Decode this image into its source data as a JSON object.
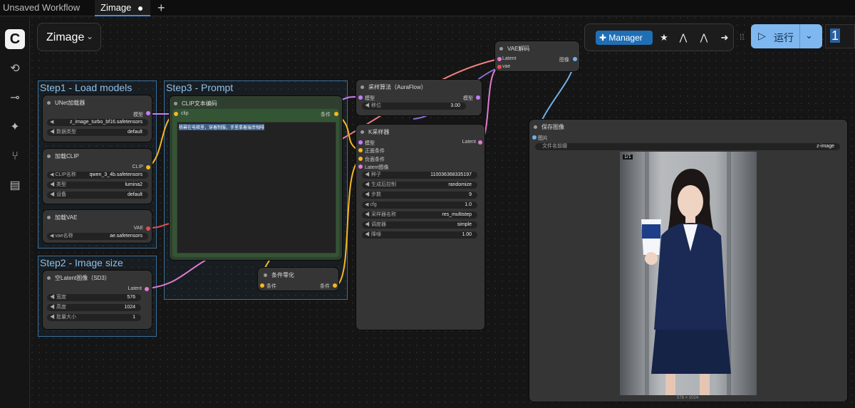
{
  "tabs": [
    {
      "label": "Unsaved Workflow"
    },
    {
      "label": "Zimage"
    }
  ],
  "workflow_select": {
    "label": "Zimage"
  },
  "toolbar": {
    "manager_label": "Manager",
    "run_label": "运行",
    "queue_count": "1"
  },
  "groups": {
    "step1": "Step1 - Load models",
    "step2": "Step2 - Image size",
    "step3": "Step3 - Prompt"
  },
  "nodes": {
    "unet": {
      "title": "UNet加载器",
      "out": "模型",
      "w1_value": "z_image_turbo_bf16.safetensors",
      "w2_label": "数据类型",
      "w2_value": "default"
    },
    "clip_loader": {
      "title": "加载CLIP",
      "out": "CLIP",
      "w1_label": "CLIP名称",
      "w1_value": "qwen_3_4b.safetensors",
      "w2_label": "类型",
      "w2_value": "lumina2",
      "w3_label": "设备",
      "w3_value": "default"
    },
    "vae_loader": {
      "title": "加载VAE",
      "out": "VAE",
      "w1_label": "vae名称",
      "w1_value": "ae.safetensors"
    },
    "latent": {
      "title": "空Latent图像（SD3）",
      "out": "Latent",
      "w1_label": "宽度",
      "w1_value": "576",
      "w2_label": "高度",
      "w2_value": "1024",
      "w3_label": "批量大小",
      "w3_value": "1"
    },
    "clip_encode": {
      "title": "CLIP文本编码",
      "in": "clip",
      "out": "条件",
      "text": "杨幂在电梯里，穿着制服，手里拿着瑞幸咖啡"
    },
    "zero": {
      "title": "条件零化",
      "in": "条件",
      "out": "条件"
    },
    "auraflow": {
      "title": "采样算法（AuraFlow）",
      "in": "模型",
      "out": "模型",
      "w1_label": "移位",
      "w1_value": "3.00"
    },
    "ksampler": {
      "title": "K采样器",
      "inputs": [
        "模型",
        "正面条件",
        "负面条件",
        "Latent图像"
      ],
      "out": "Latent",
      "widgets": [
        {
          "label": "种子",
          "value": "110036368335197"
        },
        {
          "label": "生成后控制",
          "value": "randomize"
        },
        {
          "label": "步数",
          "value": "9"
        },
        {
          "label": "cfg",
          "value": "1.0"
        },
        {
          "label": "采样器名称",
          "value": "res_multistep"
        },
        {
          "label": "调度器",
          "value": "simple"
        },
        {
          "label": "降噪",
          "value": "1.00"
        }
      ]
    },
    "vae_decode": {
      "title": "VAE解码",
      "in1": "Latent",
      "in2": "vae",
      "out": "图像"
    },
    "save_image": {
      "title": "保存图像",
      "in": "图片",
      "w1_label": "文件名前缀",
      "w1_value": "z-image",
      "size": "576 × 1024"
    }
  },
  "colors": {
    "group_border": "#3a6f99",
    "run_button": "#7fb8f0",
    "manager_button": "#1f6fb5",
    "clip_node": "#335533"
  }
}
